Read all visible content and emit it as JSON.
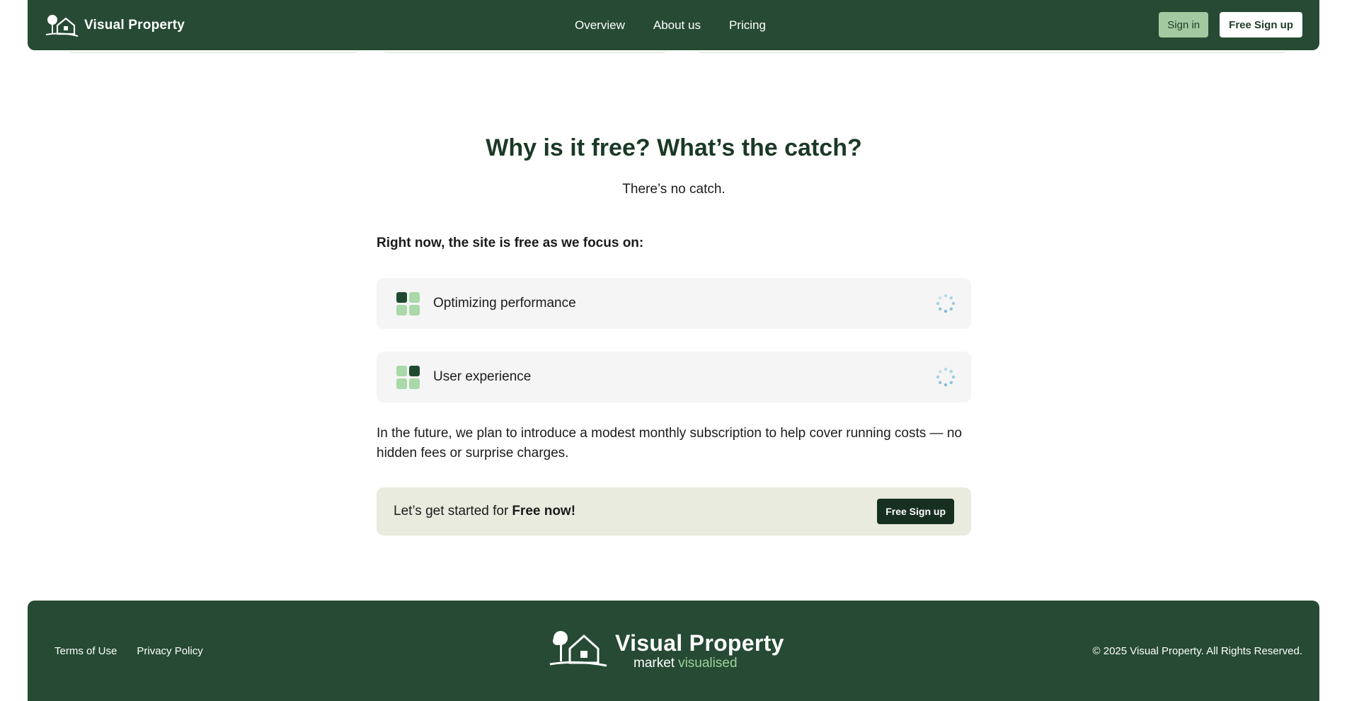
{
  "header": {
    "brand": "Visual Property",
    "nav": [
      "Overview",
      "About us",
      "Pricing"
    ],
    "sign_in": "Sign in",
    "sign_up": "Free Sign up"
  },
  "main": {
    "title": "Why is it free? What’s the catch?",
    "subtitle": "There’s no catch.",
    "focus_heading": "Right now, the site is free as we focus on:",
    "focus_items": [
      {
        "label": "Optimizing performance",
        "icon": "grid-icon"
      },
      {
        "label": "User experience",
        "icon": "grid-icon"
      }
    ],
    "paragraph": "In the future, we plan to introduce a modest monthly subscription to help cover running costs — no hidden fees or surprise charges.",
    "cta": {
      "text": "Let’s get started for",
      "bold": "Free now!",
      "button": "Free Sign up"
    }
  },
  "footer": {
    "links": [
      "Terms of Use",
      "Privacy Policy"
    ],
    "brand": "Visual Property",
    "tagline_1": "market",
    "tagline_2": "visualised",
    "copyright": "© 2025 Visual Property. All Rights Reserved."
  },
  "colors": {
    "header_bg": "#264a33",
    "sign_in_bg": "#a3c9a0",
    "card_bg": "#f5f5f5",
    "cta_bg": "#e9ebde",
    "cta_button_bg": "#172f21",
    "accent_light_green": "#9fd19a"
  }
}
